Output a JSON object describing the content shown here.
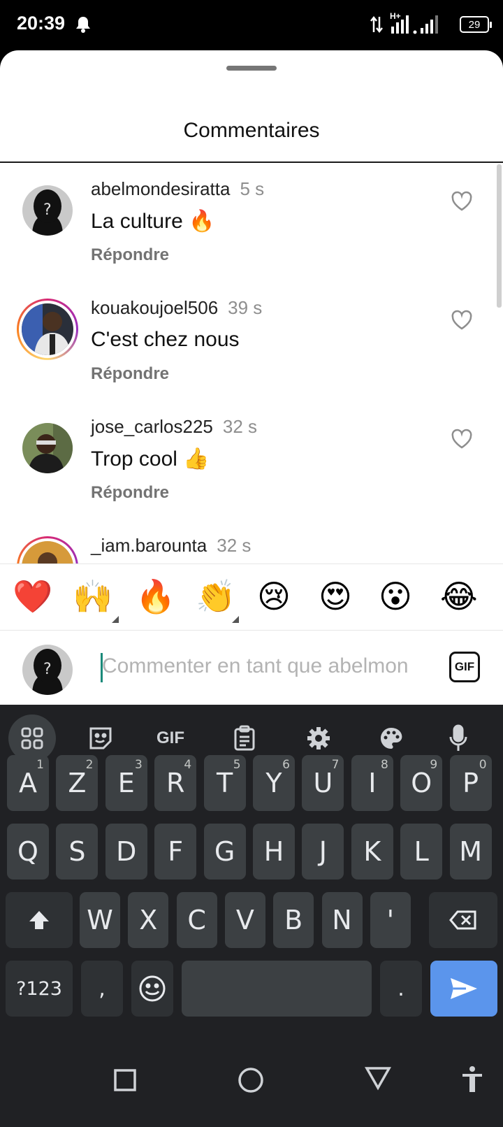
{
  "status_bar": {
    "time": "20:39",
    "bell_icon": "bell-icon",
    "network": "H+",
    "battery": "29"
  },
  "sheet": {
    "title": "Commentaires"
  },
  "comments": [
    {
      "username": "abelmondesiratta",
      "time": "5 s",
      "text": "La culture 🔥",
      "reply": "Répondre",
      "has_story_ring": false
    },
    {
      "username": "kouakoujoel506",
      "time": "39 s",
      "text": "C'est chez nous",
      "reply": "Répondre",
      "has_story_ring": true
    },
    {
      "username": "jose_carlos225",
      "time": "32 s",
      "text": "Trop cool 👍",
      "reply": "Répondre",
      "has_story_ring": false
    },
    {
      "username": "_iam.barounta",
      "time": "32 s",
      "text": "",
      "reply": "",
      "has_story_ring": true
    }
  ],
  "emoji_bar": [
    "❤️",
    "🙌",
    "🔥",
    "👏",
    "😢",
    "😍",
    "😮",
    "😂"
  ],
  "composer": {
    "placeholder": "Commenter en tant que abelmon",
    "gif_label": "GIF"
  },
  "keyboard": {
    "toolbar": {
      "gif_label": "GIF"
    },
    "row1": [
      {
        "key": "A",
        "hint": "1"
      },
      {
        "key": "Z",
        "hint": "2"
      },
      {
        "key": "E",
        "hint": "3"
      },
      {
        "key": "R",
        "hint": "4"
      },
      {
        "key": "T",
        "hint": "5"
      },
      {
        "key": "Y",
        "hint": "6"
      },
      {
        "key": "U",
        "hint": "7"
      },
      {
        "key": "I",
        "hint": "8"
      },
      {
        "key": "O",
        "hint": "9"
      },
      {
        "key": "P",
        "hint": "0"
      }
    ],
    "row2": [
      "Q",
      "S",
      "D",
      "F",
      "G",
      "H",
      "J",
      "K",
      "L",
      "M"
    ],
    "row3": [
      "W",
      "X",
      "C",
      "V",
      "B",
      "N",
      "'"
    ],
    "row4": {
      "symbols": "?123",
      "comma": ",",
      "period": "."
    }
  },
  "colors": {
    "keyboard_bg": "#202124",
    "key_bg": "#3c4043",
    "enter_bg": "#5b95ec",
    "cursor": "#1a8a7a"
  }
}
